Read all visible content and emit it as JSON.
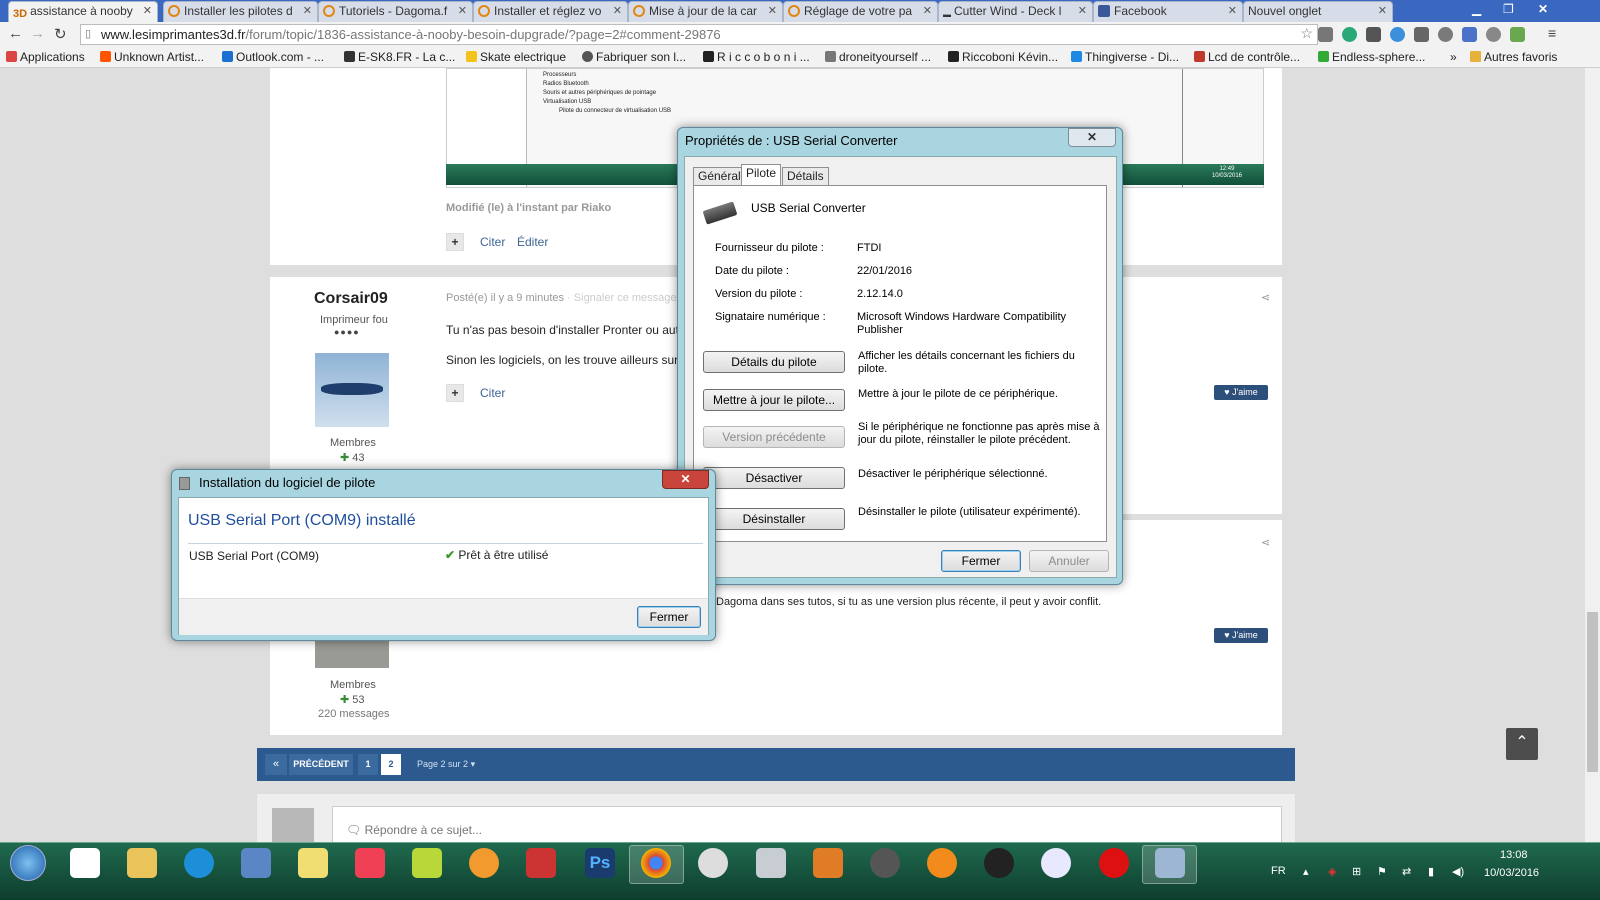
{
  "browser": {
    "tabs": [
      {
        "label": "assistance à nooby",
        "fav": "3D",
        "active": true
      },
      {
        "label": "Installer les pilotes d",
        "fav": "ring"
      },
      {
        "label": "Tutoriels - Dagoma.f",
        "fav": "ring"
      },
      {
        "label": "Installer et réglez vo",
        "fav": "ring"
      },
      {
        "label": "Mise à jour de la car",
        "fav": "ring"
      },
      {
        "label": "Réglage de votre pa",
        "fav": "ring"
      },
      {
        "label": "Cutter Wind - Deck l",
        "fav": "esk8"
      },
      {
        "label": "Facebook",
        "fav": "fb"
      },
      {
        "label": "Nouvel onglet",
        "fav": "none"
      }
    ],
    "url_host": "www.lesimprimantes3d.fr",
    "url_rest": "/forum/topic/1836-assistance-à-nooby-besoin-dupgrade/?page=2#comment-29876",
    "bookmarks": [
      "Applications",
      "Unknown Artist...",
      "Outlook.com - ...",
      "E-SK8.FR - La c...",
      "Skate electrique",
      "Fabriquer son l...",
      "R i c c o b o n i ...",
      "droneityourself ...",
      "Riccoboni Kévin...",
      "Thingiverse - Di...",
      "Lcd de contrôle...",
      "Endless-sphere...",
      "Autres favoris"
    ],
    "bookmark_overflow": "»"
  },
  "devtree": [
    "Processeurs",
    "Radios Bluetooth",
    "Souris et autres périphériques de pointage",
    "Virtualisation USB",
    "Pilote du connecteur de virtualisation USB"
  ],
  "clock_small": {
    "time": "12:49",
    "date": "10/03/2016"
  },
  "posts": {
    "modified": "Modifié (le) à l'instant par Riako",
    "cite": "Citer",
    "edit": "Éditer",
    "author": "Corsair09",
    "rank": "Imprimeur fou",
    "rank_dots": "●●●●",
    "posted": "Posté(e) il y a 9 minutes",
    "report": "· Signaler ce message",
    "line1": "Tu n'as pas besoin d'installer Pronter ou autr",
    "line2": "Sinon les logiciels, on les trouve ailleurs sur le",
    "members": "Membres",
    "rep1": "43",
    "like": "J'aime",
    "second_line": "Dagoma dans ses tutos, si tu as une version plus récente, il peut y avoir conflit.",
    "rep2": "53",
    "msgs2": "220 messages",
    "label_hidden": "Signaler"
  },
  "pagination": {
    "prev": "PRÉCÉDENT",
    "pages": [
      "1",
      "2"
    ],
    "info": "Page 2 sur 2"
  },
  "reply": {
    "placeholder": "Répondre à ce sujet..."
  },
  "props_dialog": {
    "title": "Propriétés de : USB Serial Converter",
    "tabs": [
      "Général",
      "Pilote",
      "Détails"
    ],
    "device": "USB Serial Converter",
    "fields": [
      {
        "label": "Fournisseur du pilote :",
        "value": "FTDI"
      },
      {
        "label": "Date du pilote :",
        "value": "22/01/2016"
      },
      {
        "label": "Version du pilote :",
        "value": "2.12.14.0"
      },
      {
        "label": "Signataire numérique :",
        "value": "Microsoft Windows Hardware Compatibility Publisher"
      }
    ],
    "actions": [
      {
        "button": "Détails du pilote",
        "desc": "Afficher les détails concernant les fichiers du pilote."
      },
      {
        "button": "Mettre à jour le pilote...",
        "desc": "Mettre à jour le pilote de ce périphérique."
      },
      {
        "button": "Version précédente",
        "desc": "Si le périphérique ne fonctionne pas après mise à jour du pilote, réinstaller le pilote précédent."
      },
      {
        "button": "Désactiver",
        "desc": "Désactiver le périphérique sélectionné."
      },
      {
        "button": "Désinstaller",
        "desc": "Désinstaller le pilote (utilisateur expérimenté)."
      }
    ],
    "ok": "Fermer",
    "cancel": "Annuler"
  },
  "install_dialog": {
    "title": "Installation du logiciel de pilote",
    "heading": "USB Serial Port (COM9) installé",
    "device": "USB Serial Port (COM9)",
    "status": "Prêt à être utilisé",
    "close": "Fermer"
  },
  "taskbar": {
    "lang": "FR",
    "time": "13:08",
    "date": "10/03/2016"
  },
  "colors": {
    "tabstrip": "#3a68c0",
    "pagination": "#2d5a8e",
    "taskbar": "#1f6a4e",
    "link_blue": "#1f4e9c"
  }
}
